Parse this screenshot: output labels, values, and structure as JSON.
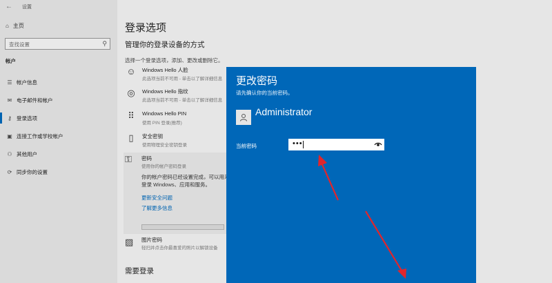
{
  "app": {
    "title": "设置",
    "back_icon": "back-arrow-icon"
  },
  "sidebar": {
    "home": "主页",
    "search_placeholder": "查找设置",
    "section": "帐户",
    "items": [
      {
        "label": "帐户信息",
        "icon": "person-card-icon",
        "glyph": "☰"
      },
      {
        "label": "电子邮件和帐户",
        "icon": "mail-icon",
        "glyph": "✉"
      },
      {
        "label": "登录选项",
        "icon": "key-icon",
        "glyph": "⚷"
      },
      {
        "label": "连接工作或学校帐户",
        "icon": "briefcase-icon",
        "glyph": "▣"
      },
      {
        "label": "其他用户",
        "icon": "person-add-icon",
        "glyph": "⚇"
      },
      {
        "label": "同步你的设置",
        "icon": "sync-icon",
        "glyph": "⟳"
      }
    ]
  },
  "main": {
    "title": "登录选项",
    "subtitle": "管理你的登录设备的方式",
    "hint": "选择一个登录选项，添加、更改或删除它。",
    "options": [
      {
        "title": "Windows Hello 人脸",
        "sub": "此选项当前不可用 - 单击以了解详细信息",
        "icon": "face-icon",
        "glyph": "☺"
      },
      {
        "title": "Windows Hello 指纹",
        "sub": "此选项当前不可用 - 单击以了解详细信息",
        "icon": "fingerprint-icon",
        "glyph": "◎"
      },
      {
        "title": "Windows Hello PIN",
        "sub": "使用 PIN 登录(推荐)",
        "icon": "pin-keypad-icon",
        "glyph": "⠿"
      },
      {
        "title": "安全密钥",
        "sub": "使用物理安全密钥登录",
        "icon": "usb-key-icon",
        "glyph": "▯"
      }
    ],
    "password": {
      "title": "密码",
      "sub": "使用你的帐户密码登录",
      "desc": "你的帐户密码已经设置完成，可以用来登录 Windows、应用和服务。",
      "link1": "更新安全问题",
      "link2": "了解更多信息"
    },
    "picture": {
      "title": "图片密码",
      "sub": "轻扫并点击你最喜爱的照片以解锁设备"
    },
    "section2": "需要登录"
  },
  "dialog": {
    "title": "更改密码",
    "subtitle": "请先确认你的当前密码。",
    "user": "Administrator",
    "field_label": "当前密码",
    "field_value": "•••"
  },
  "annotation": {
    "color": "#e0262c"
  }
}
